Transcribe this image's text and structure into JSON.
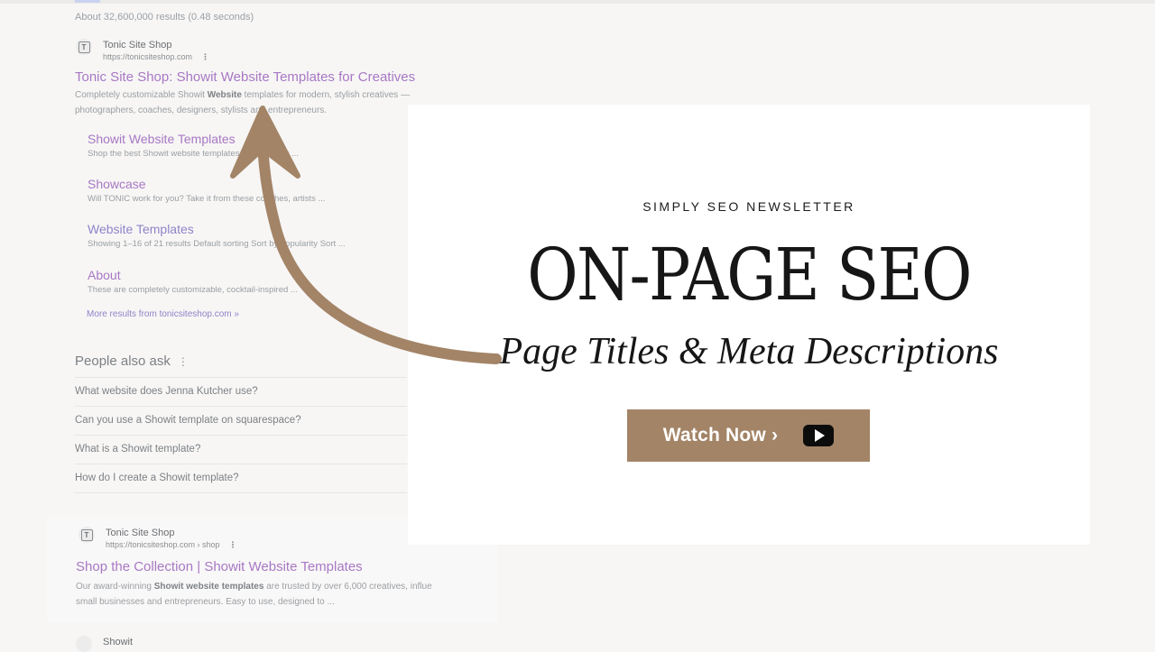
{
  "serp": {
    "stats": "About 32,600,000 results (0.48 seconds)",
    "result1": {
      "site_name": "Tonic Site Shop",
      "url": "https://tonicsiteshop.com",
      "title": "Tonic Site Shop: Showit Website Templates for Creatives",
      "snippet_a": "Completely customizable Showit ",
      "snippet_bold": "Website",
      "snippet_b": " templates for modern, stylish creatives —",
      "snippet_line2": "photographers, coaches, designers, stylists and entrepreneurs.",
      "sitelinks": [
        {
          "title": "Showit Website Templates",
          "desc": "Shop the best Showit website templates designed for ..."
        },
        {
          "title": "Showcase",
          "desc": "Will TONIC work for you? Take it from these coaches, artists ..."
        },
        {
          "title": "Website Templates",
          "desc": "Showing 1–16 of 21 results Default sorting Sort by popularity Sort ..."
        },
        {
          "title": "About",
          "desc": "These are completely customizable, cocktail-inspired ..."
        }
      ],
      "more": "More results from tonicsiteshop.com »"
    },
    "people_also_ask": {
      "heading": "People also ask",
      "questions": [
        "What website does Jenna Kutcher use?",
        "Can you use a Showit template on squarespace?",
        "What is a Showit template?",
        "How do I create a Showit template?"
      ]
    },
    "result2": {
      "site_name": "Tonic Site Shop",
      "url": "https://tonicsiteshop.com › shop",
      "title": "Shop the Collection | Showit Website Templates",
      "snippet_a": "Our award-winning ",
      "snippet_bold": "Showit website templates",
      "snippet_b": " are trusted by over 6,000 creatives, influe",
      "snippet_line2": "small businesses and entrepreneurs. Easy to use, designed to ..."
    },
    "result3": {
      "site_name": "Showit"
    },
    "favicon_letter": "T",
    "more_icon": "⋮"
  },
  "card": {
    "kicker": "SIMPLY SEO NEWSLETTER",
    "headline": "ON-PAGE SEO",
    "subhead": "Page Titles & Meta Descriptions",
    "cta_label": "Watch Now ›",
    "cta_icon": "youtube-play-icon"
  },
  "colors": {
    "accent": "#a38467",
    "link": "#a878c4",
    "background": "#f7f6f5",
    "card": "#ffffff"
  }
}
